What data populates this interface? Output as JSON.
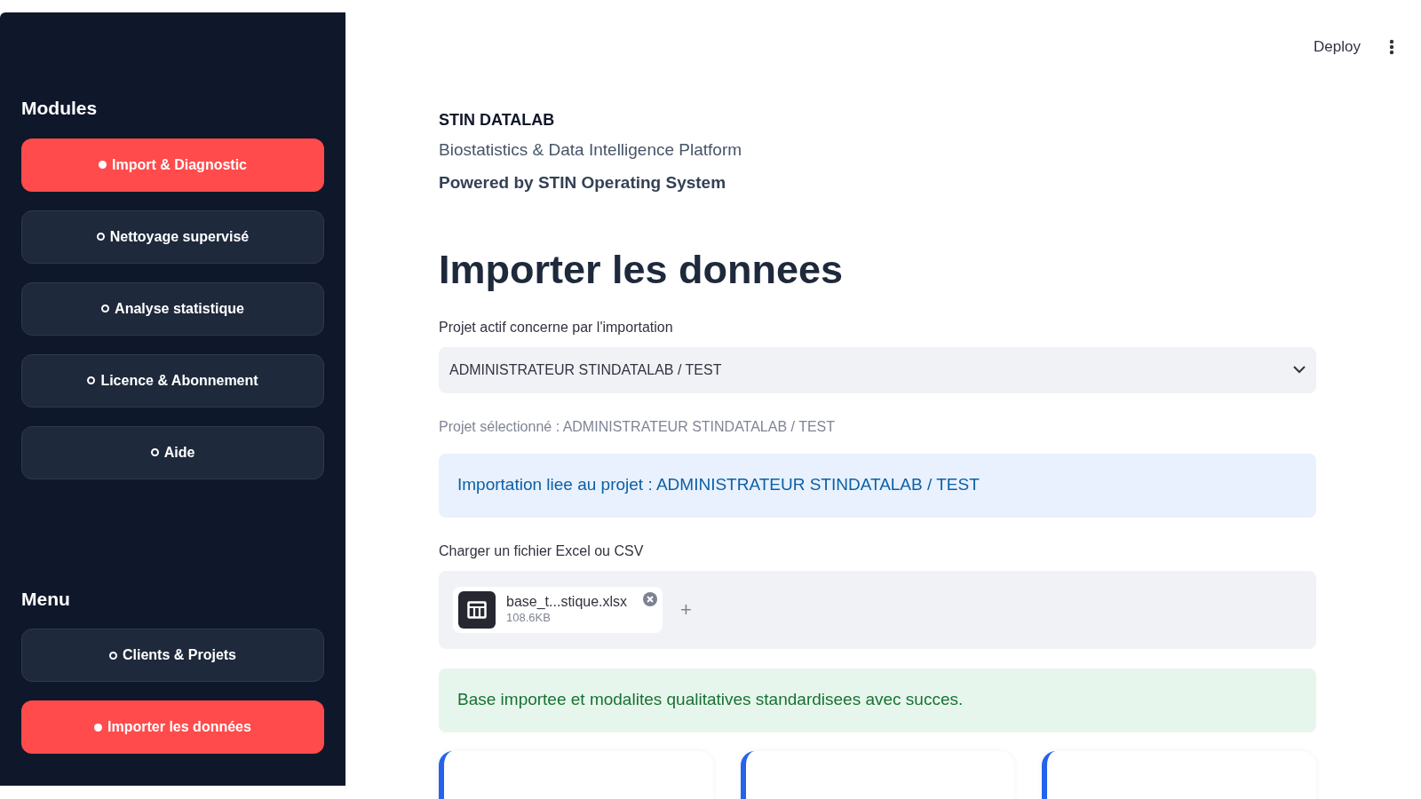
{
  "sidebar": {
    "sections": [
      {
        "title": "Modules",
        "items": [
          {
            "label": "Import & Diagnostic",
            "selected": true
          },
          {
            "label": "Nettoyage supervisé",
            "selected": false
          },
          {
            "label": "Analyse statistique",
            "selected": false
          },
          {
            "label": "Licence & Abonnement",
            "selected": false
          },
          {
            "label": "Aide",
            "selected": false
          }
        ]
      },
      {
        "title": "Menu",
        "items": [
          {
            "label": "Clients & Projets",
            "selected": false
          },
          {
            "label": "Importer les données",
            "selected": true
          }
        ]
      }
    ]
  },
  "toolbar": {
    "deploy": "Deploy"
  },
  "header": {
    "brand": "STIN DATALAB",
    "subtitle": "Biostatistics & Data Intelligence Platform",
    "powered": "Powered by STIN Operating System"
  },
  "page_title": "Importer les donnees",
  "project_select": {
    "label": "Projet actif concerne par l'importation",
    "value": "ADMINISTRATEUR STINDATALAB / TEST"
  },
  "selected_caption": "Projet sélectionné : ADMINISTRATEUR STINDATALAB / TEST",
  "info_alert": "Importation liee au projet : ADMINISTRATEUR STINDATALAB / TEST",
  "uploader": {
    "label": "Charger un fichier Excel ou CSV",
    "file_name": "base_t...stique.xlsx",
    "file_size": "108.6KB",
    "add": "+"
  },
  "success_alert": "Base importee et modalites qualitatives standardisees avec succes.",
  "metric_cards": [
    {
      "kind": "metric"
    },
    {
      "kind": "metric"
    },
    {
      "kind": "metric"
    }
  ]
}
